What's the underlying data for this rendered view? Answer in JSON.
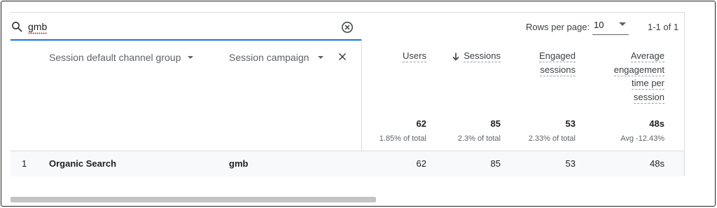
{
  "search": {
    "query": "gmb"
  },
  "pagination": {
    "rows_per_page_label": "Rows per page:",
    "rows_per_page_value": "10",
    "range": "1-1 of 1"
  },
  "dimensions": [
    {
      "label": "Session default channel group"
    },
    {
      "label": "Session campaign"
    }
  ],
  "metrics": {
    "users": {
      "label": [
        "Users"
      ],
      "total": "62",
      "pct": "1.85% of total"
    },
    "sessions": {
      "label": [
        "Sessions"
      ],
      "total": "85",
      "pct": "2.3% of total",
      "sorted": "descending"
    },
    "engaged": {
      "label": [
        "Engaged",
        "sessions"
      ],
      "total": "53",
      "pct": "2.33% of total"
    },
    "avg_time": {
      "label": [
        "Average",
        "engagement",
        "time per",
        "session"
      ],
      "total": "48s",
      "pct": "Avg -12.43%"
    }
  },
  "rows": [
    {
      "index": "1",
      "channel": "Organic Search",
      "campaign": "gmb",
      "users": "62",
      "sessions": "85",
      "engaged": "53",
      "avg_time": "48s"
    }
  ],
  "colors": {
    "accent": "#1a73e8",
    "spellcheck": "#d93025",
    "row_highlight": "#f8f9fa"
  }
}
